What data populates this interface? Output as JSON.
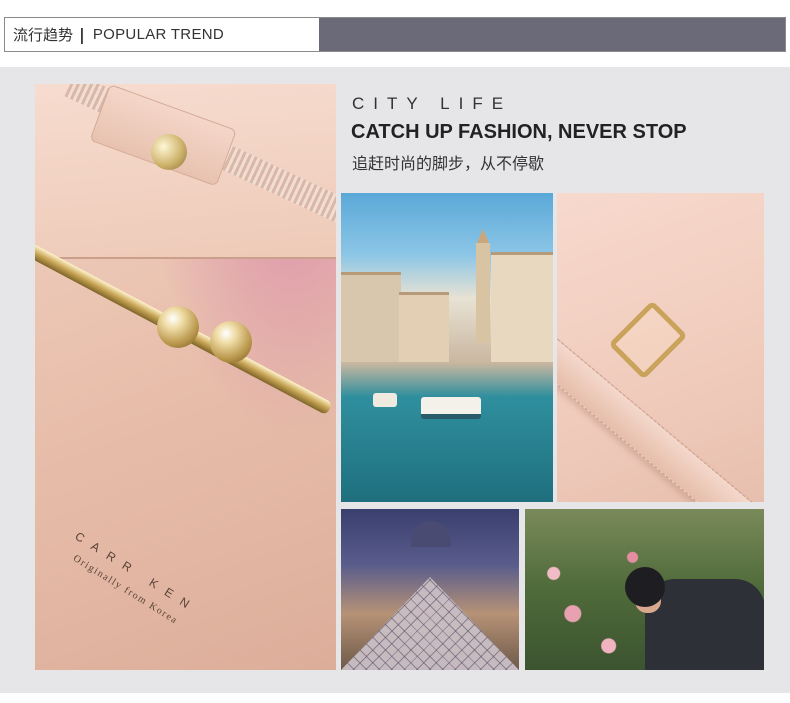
{
  "header": {
    "title_cn": "流行趋势",
    "separator": "|",
    "title_en": "POPULAR TREND",
    "accent_color": "#6b6a78"
  },
  "headline": {
    "eyebrow": "CITY LIFE",
    "title": "CATCH UP FASHION, NEVER STOP",
    "subtitle_cn": "追赶时尚的脚步，从不停歇"
  },
  "product": {
    "brand_name": "CARR KEN",
    "brand_tagline": "Originally from Korea"
  },
  "photos": {
    "bag": "bag-closeup-photo",
    "venice": "venice-canal-photo",
    "strap": "strap-buckle-photo",
    "louvre": "louvre-pyramid-photo",
    "garden": "garden-rose-photo"
  },
  "colors": {
    "panel_bg": "#e6e6e9",
    "text_dark": "#222222"
  }
}
